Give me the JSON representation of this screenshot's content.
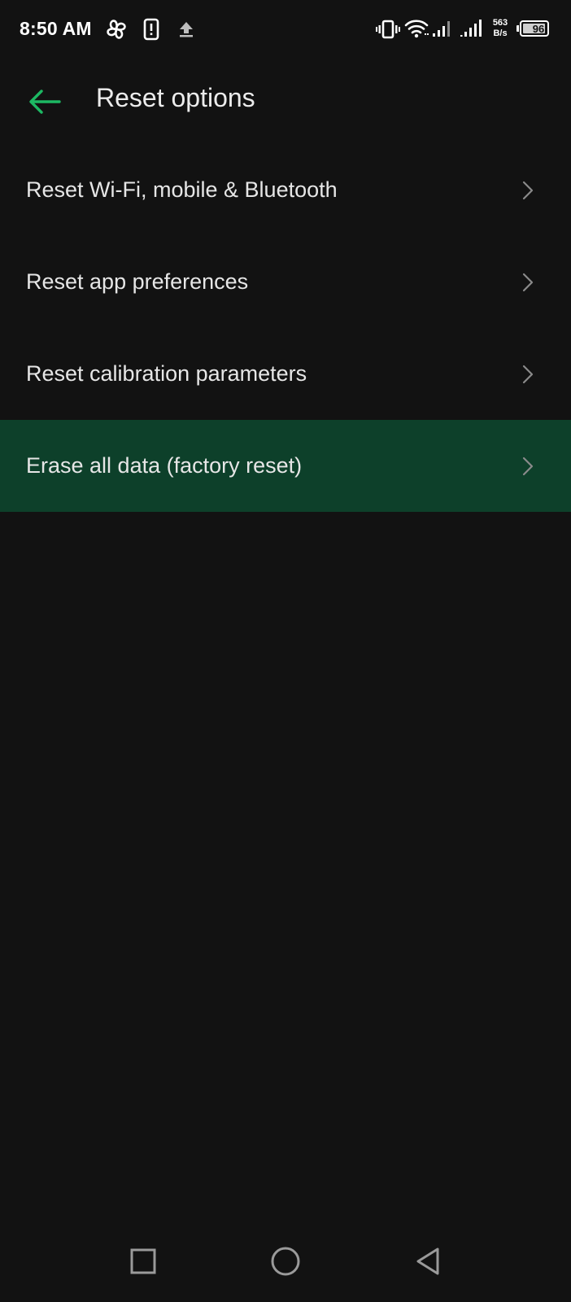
{
  "status_bar": {
    "time": "8:50 AM",
    "net_speed_value": "563",
    "net_speed_unit": "B/s",
    "battery_level": "96",
    "icons": [
      "pinwheel-icon",
      "phone-alert-icon",
      "upload-icon",
      "vibrate-icon",
      "wifi-icon",
      "signal-1-icon",
      "signal-2-icon"
    ]
  },
  "header": {
    "back_icon": "arrow-left-icon",
    "title": "Reset options"
  },
  "list": {
    "items": [
      {
        "label": "Reset Wi-Fi, mobile & Bluetooth"
      },
      {
        "label": "Reset app preferences"
      },
      {
        "label": "Reset calibration parameters"
      },
      {
        "label": "Erase all data (factory reset)",
        "highlighted": true
      }
    ]
  },
  "nav_bar": {
    "buttons": [
      "recents-square-icon",
      "home-circle-icon",
      "back-triangle-icon"
    ]
  },
  "colors": {
    "background": "#121212",
    "accent": "#1db863",
    "highlight": "#0d402a",
    "text": "#e6e6e6",
    "chevron": "#8a8a8a"
  }
}
